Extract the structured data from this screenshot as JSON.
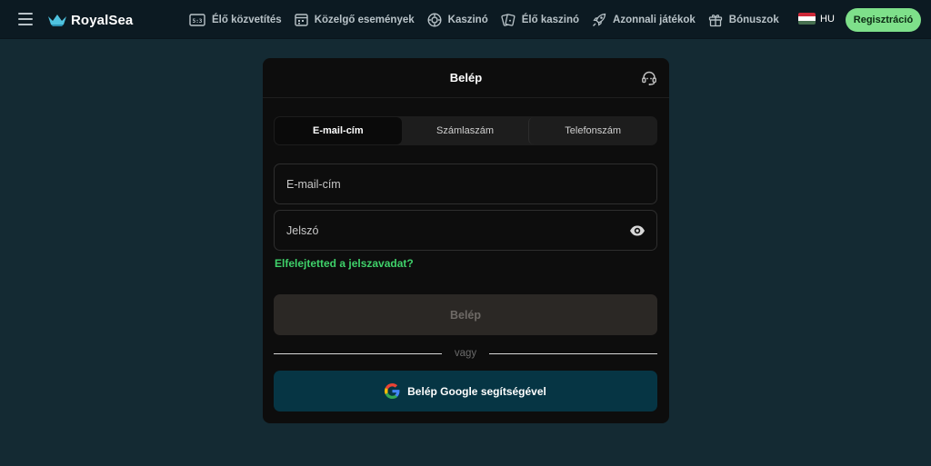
{
  "topbar": {
    "brand": "RoyalSea",
    "nav": [
      {
        "label": "Élő közvetítés",
        "icon": "live-scoreboard-icon"
      },
      {
        "label": "Közelgő események",
        "icon": "calendar-icon"
      },
      {
        "label": "Kaszinó",
        "icon": "casino-chip-icon"
      },
      {
        "label": "Élő kaszinó",
        "icon": "cards-icon"
      },
      {
        "label": "Azonnali játékok",
        "icon": "rocket-icon"
      },
      {
        "label": "Bónuszok",
        "icon": "gift-icon"
      }
    ],
    "language": "HU",
    "register_label": "Regisztráció"
  },
  "login": {
    "title": "Belép",
    "tabs": [
      "E-mail-cím",
      "Számlaszám",
      "Telefonszám"
    ],
    "active_tab": "E-mail-cím",
    "email_placeholder": "E-mail-cím",
    "password_placeholder": "Jelszó",
    "forgot_label": "Elfelejtetted a jelszavadat?",
    "submit_label": "Belép",
    "divider_label": "vagy",
    "google_label": "Belép Google segítségével"
  },
  "colors": {
    "background": "#142a33",
    "topbar": "#0c1a22",
    "accent_green": "#7ee08a",
    "link_green": "#3fd16a",
    "google_button": "#063544"
  }
}
